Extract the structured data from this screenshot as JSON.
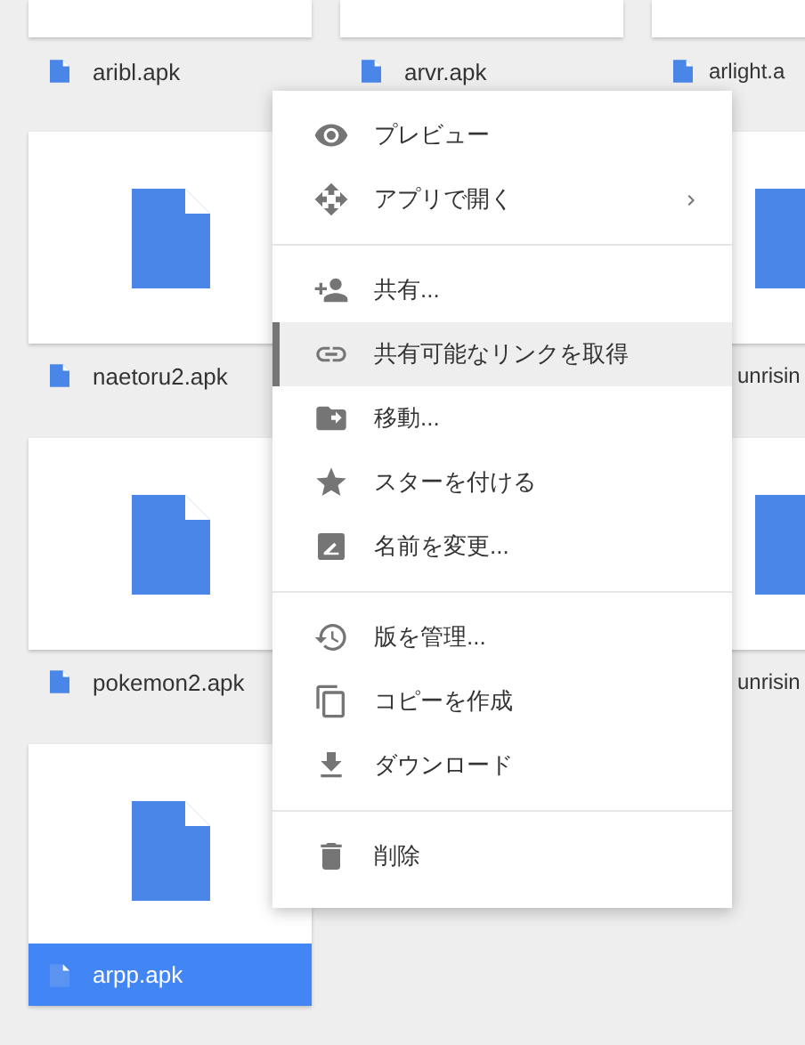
{
  "files": [
    {
      "name": "aribl.apk",
      "kind": "cut-top",
      "selected": false
    },
    {
      "name": "arvr.apk",
      "kind": "cut-top",
      "selected": false
    },
    {
      "name": "arlight.a",
      "kind": "cut-top",
      "selected": false
    },
    {
      "name": "naetoru2.apk",
      "kind": "full",
      "selected": false
    },
    {
      "name": "unrisin",
      "kind": "edge",
      "selected": false
    },
    {
      "name": "pokemon2.apk",
      "kind": "full",
      "selected": false
    },
    {
      "name": "unrisin",
      "kind": "edge",
      "selected": false
    },
    {
      "name": "arpp.apk",
      "kind": "full",
      "selected": true
    }
  ],
  "menu": {
    "groups": [
      {
        "items": [
          {
            "label": "プレビュー",
            "selected": false,
            "has_submenu": false
          },
          {
            "label": "アプリで開く",
            "selected": false,
            "has_submenu": true
          }
        ]
      },
      {
        "items": [
          {
            "label": "共有...",
            "selected": false,
            "has_submenu": false
          },
          {
            "label": "共有可能なリンクを取得",
            "selected": true,
            "has_submenu": false
          },
          {
            "label": "移動...",
            "selected": false,
            "has_submenu": false
          },
          {
            "label": "スターを付ける",
            "selected": false,
            "has_submenu": false
          },
          {
            "label": "名前を変更...",
            "selected": false,
            "has_submenu": false
          }
        ]
      },
      {
        "items": [
          {
            "label": "版を管理...",
            "selected": false,
            "has_submenu": false
          },
          {
            "label": "コピーを作成",
            "selected": false,
            "has_submenu": false
          },
          {
            "label": "ダウンロード",
            "selected": false,
            "has_submenu": false
          }
        ]
      },
      {
        "items": [
          {
            "label": "削除",
            "selected": false,
            "has_submenu": false
          }
        ]
      }
    ]
  }
}
